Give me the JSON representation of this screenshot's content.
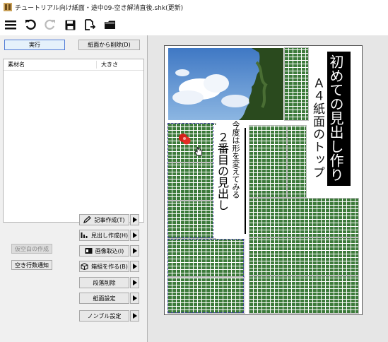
{
  "window": {
    "title": "チュートリアル向け紙面・途中09-空き解消直後.shk(更新)"
  },
  "toolbar": {
    "icons": [
      "menu-icon",
      "undo-icon",
      "redo-icon",
      "save-icon",
      "export-icon",
      "folder-icon"
    ]
  },
  "actions": {
    "run_label": "実行",
    "remove_label": "紙面から削除(D)"
  },
  "material": {
    "col_name": "素材名",
    "col_size": "大きさ"
  },
  "side": {
    "fill_label": "仮空白の作成",
    "notify_label": "空き行数通知"
  },
  "menu": {
    "article": "記事作成(T)",
    "headline": "見出し作成(H)",
    "image": "画像取込(I)",
    "box": "箱組を作る(B)",
    "delete_para": "段落削除",
    "page_setting": "紙面設定",
    "nombre": "ノンブル設定"
  },
  "paper": {
    "headline_main": "初めての見出し作り",
    "headline_sub": "Ａ４紙面のトップ",
    "second_headline": "２番目の見出し",
    "second_sub": "今度は形を変えてみる"
  }
}
